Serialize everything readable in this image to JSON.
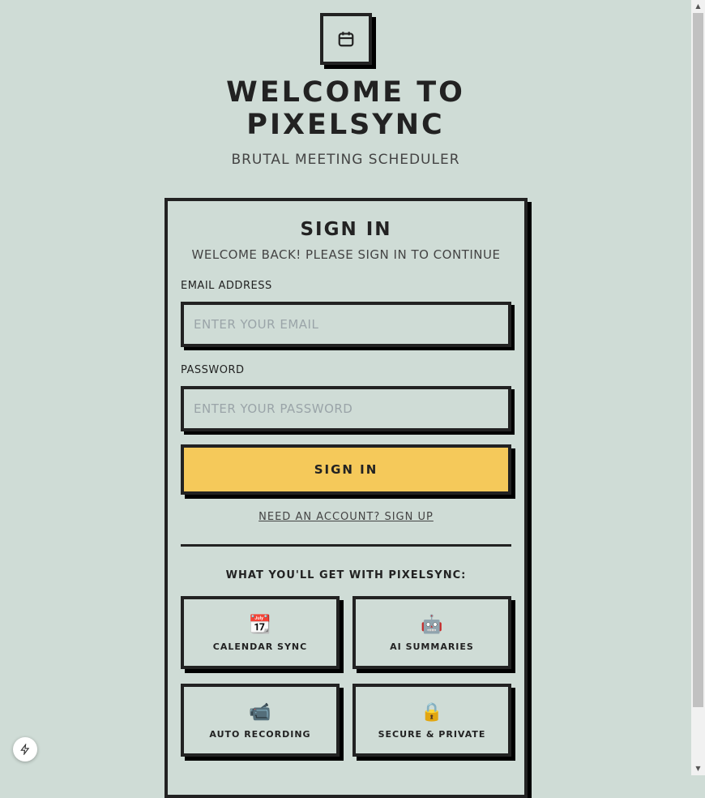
{
  "header": {
    "title_line1": "WELCOME TO",
    "title_line2": "PIXELSYNC",
    "subtitle": "BRUTAL MEETING SCHEDULER"
  },
  "form": {
    "heading": "SIGN IN",
    "subheading": "WELCOME BACK! PLEASE SIGN IN TO CONTINUE",
    "email_label": "EMAIL ADDRESS",
    "email_placeholder": "ENTER YOUR EMAIL",
    "email_value": "",
    "password_label": "PASSWORD",
    "password_placeholder": "ENTER YOUR PASSWORD",
    "password_value": "",
    "submit_label": "SIGN IN",
    "signup_link": "NEED AN ACCOUNT? SIGN UP"
  },
  "features": {
    "heading": "WHAT YOU'LL GET WITH PIXELSYNC:",
    "items": [
      {
        "icon": "📆",
        "label": "CALENDAR SYNC"
      },
      {
        "icon": "🤖",
        "label": "AI SUMMARIES"
      },
      {
        "icon": "📹",
        "label": "AUTO RECORDING"
      },
      {
        "icon": "🔒",
        "label": "SECURE & PRIVATE"
      }
    ]
  },
  "colors": {
    "background": "#cfdcd6",
    "accent": "#f5c95a",
    "border": "#222222"
  }
}
